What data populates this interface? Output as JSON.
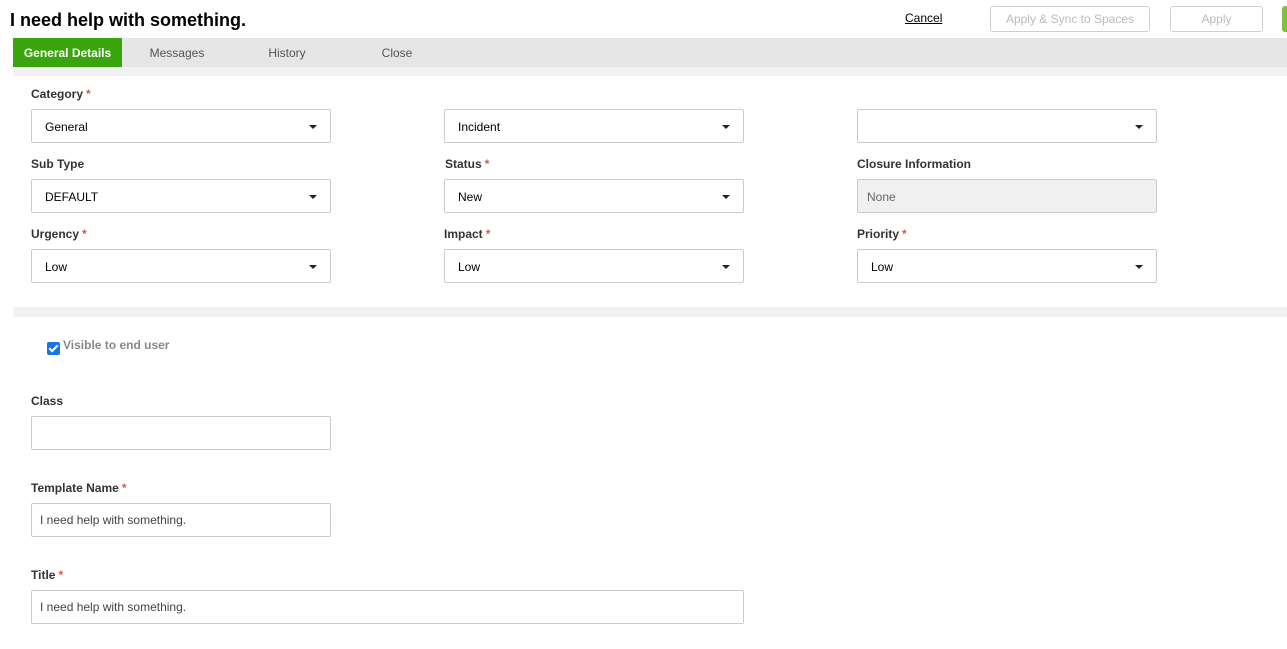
{
  "page": {
    "title": "I need help with something."
  },
  "header": {
    "cancel_label": "Cancel",
    "sync_label": "Apply & Sync to Spaces",
    "apply_label": "Apply"
  },
  "tabs": [
    {
      "label": "General Details",
      "active": true
    },
    {
      "label": "Messages"
    },
    {
      "label": "History"
    },
    {
      "label": "Close"
    }
  ],
  "fields": {
    "category": {
      "label": "Category",
      "required": "*",
      "value": "General"
    },
    "incident": {
      "value": "Incident"
    },
    "extra": {
      "value": ""
    },
    "sub_type": {
      "label": "Sub Type",
      "value": "DEFAULT"
    },
    "status": {
      "label": "Status",
      "required": "*",
      "value": "New"
    },
    "closure": {
      "label": "Closure Information",
      "value": "None"
    },
    "urgency": {
      "label": "Urgency",
      "required": "*",
      "value": "Low"
    },
    "impact": {
      "label": "Impact",
      "required": "*",
      "value": "Low"
    },
    "priority": {
      "label": "Priority",
      "required": "*",
      "value": "Low"
    },
    "visible": {
      "label": "Visible to end user",
      "checked": true
    },
    "class": {
      "label": "Class",
      "value": ""
    },
    "template_name": {
      "label": "Template Name",
      "required": "*",
      "value": "I need help with something."
    },
    "title": {
      "label": "Title",
      "required": "*",
      "value": "I need help with something."
    }
  },
  "colors": {
    "accent": "#3aa40f",
    "required": "#d9534f",
    "checkbox": "#1a73e8"
  }
}
